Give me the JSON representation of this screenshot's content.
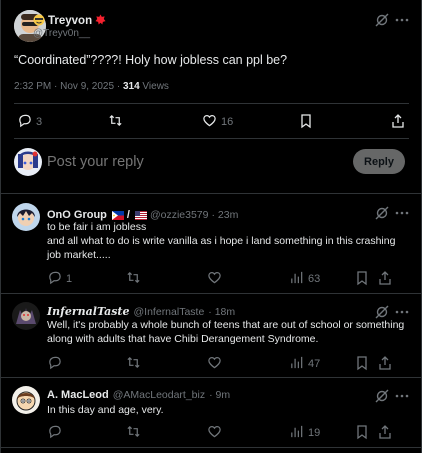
{
  "post": {
    "author_name": "Treyvon",
    "author_handle": "@Treyv0n__",
    "text": "“Coordinated”????! Holy how jobless can ppl be?",
    "time": "2:32 PM · Nov 9, 2025 · ",
    "views_count": "314",
    "views_label": " Views",
    "reply_count": "3",
    "repost_count": "",
    "like_count": "16"
  },
  "composer": {
    "placeholder": "Post your reply",
    "reply_button": "Reply"
  },
  "replies": [
    {
      "name": "OnO Group",
      "handle": "@ozzie3579",
      "time": "· 23m",
      "text": "to be fair i am jobless\nand all what to do is write vanilla as i hope i land something in this crashing job market.....",
      "reply_count": "1",
      "repost_count": "",
      "like_count": "",
      "views_count": "63"
    },
    {
      "name": "InfernalTaste",
      "handle": "@InfernalTaste",
      "time": "· 18m",
      "text": "Well, it's probably a whole bunch of teens that are out of school or something along with adults that have Chibi Derangement Syndrome.",
      "reply_count": "",
      "repost_count": "",
      "like_count": "",
      "views_count": "47"
    },
    {
      "name": "A. MacLeod",
      "handle": "@AMacLeodart_biz",
      "time": "· 9m",
      "text": "In this day and age, very.",
      "reply_count": "",
      "repost_count": "",
      "like_count": "",
      "views_count": "19"
    }
  ],
  "colors": {
    "background": "#000000",
    "text": "#e7e9ea",
    "muted": "#71767b",
    "divider": "#2f3336",
    "reply_button_bg": "#787a7a",
    "badge_red": "#f4212e"
  },
  "icons": [
    "grok-icon",
    "more-icon",
    "reply-icon",
    "repost-icon",
    "like-icon",
    "views-icon",
    "bookmark-icon",
    "share-icon"
  ]
}
